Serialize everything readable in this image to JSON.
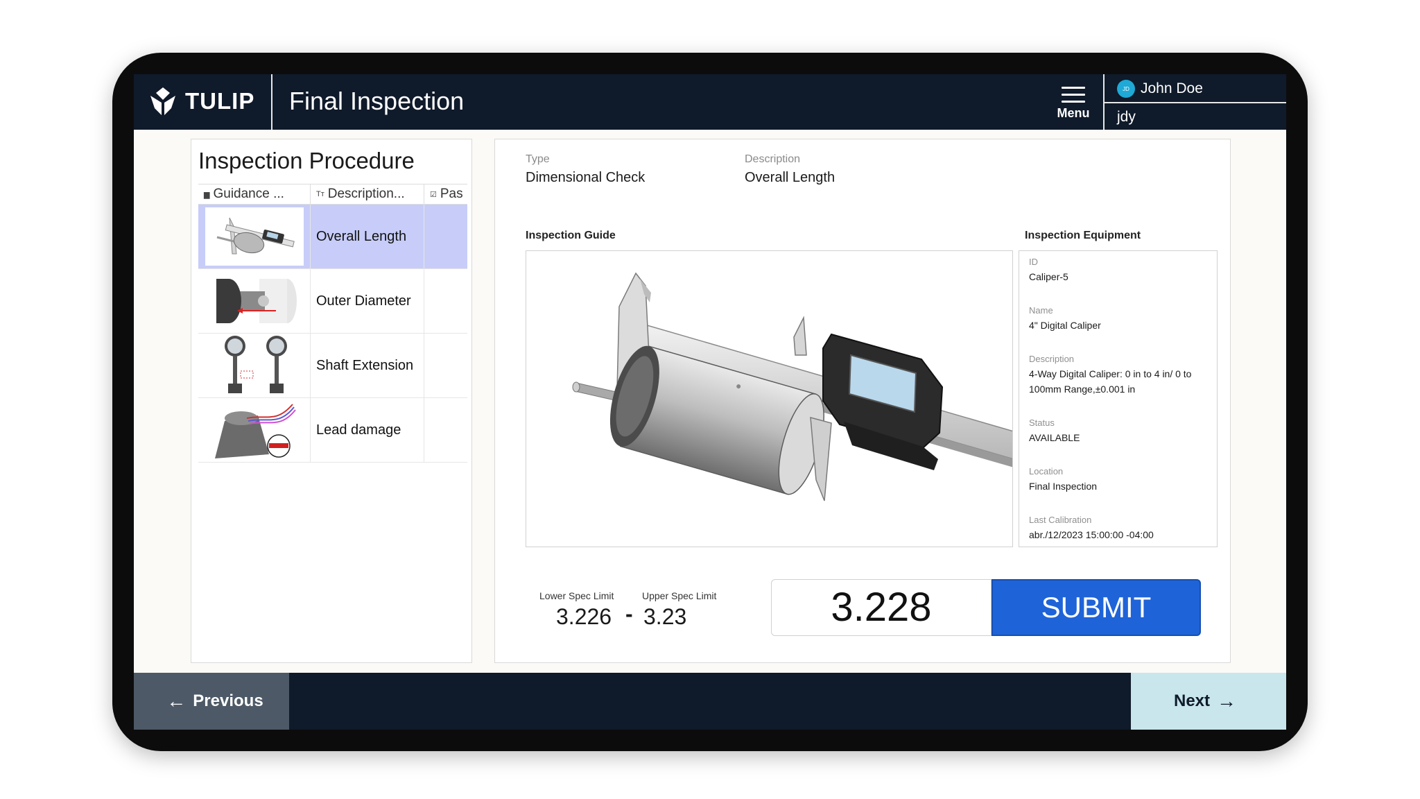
{
  "header": {
    "logo_text": "TULIP",
    "title": "Final Inspection",
    "menu_label": "Menu",
    "user_name": "John Doe",
    "user_initials": "JD",
    "user_id": "jdy"
  },
  "procedure": {
    "title": "Inspection Procedure",
    "columns": [
      "Guidance ...",
      "Description...",
      "Pas"
    ],
    "rows": [
      {
        "description": "Overall Length",
        "thumb": "caliper-cylinder",
        "selected": true
      },
      {
        "description": "Outer Diameter",
        "thumb": "outer-diameter",
        "selected": false
      },
      {
        "description": "Shaft Extension",
        "thumb": "dial-indicators",
        "selected": false
      },
      {
        "description": "Lead damage",
        "thumb": "lead-wires",
        "selected": false
      }
    ]
  },
  "detail": {
    "type_label": "Type",
    "type_value": "Dimensional Check",
    "desc_label": "Description",
    "desc_value": "Overall Length",
    "guide_label": "Inspection Guide",
    "equipment_label": "Inspection Equipment"
  },
  "equipment": {
    "id_label": "ID",
    "id_value": "Caliper-5",
    "name_label": "Name",
    "name_value": "4\" Digital Caliper",
    "desc_label": "Description",
    "desc_value": "4-Way Digital Caliper: 0 in to 4 in/ 0 to 100mm Range,±0.001 in",
    "status_label": "Status",
    "status_value": "AVAILABLE",
    "location_label": "Location",
    "location_value": "Final Inspection",
    "calibration_label": "Last Calibration",
    "calibration_value": "abr./12/2023 15:00:00 -04:00"
  },
  "spec": {
    "lower_label": "Lower Spec Limit",
    "upper_label": "Upper Spec Limit",
    "lower_value": "3.226",
    "upper_value": "3.23",
    "dash": "-"
  },
  "measurement": {
    "value": "3.228",
    "submit_label": "SUBMIT"
  },
  "footer": {
    "previous_label": "Previous",
    "next_label": "Next"
  },
  "colors": {
    "header_bg": "#0f1a2a",
    "selected_row": "#c7cdf8",
    "submit": "#1f63d8",
    "next_button": "#c8e6ec",
    "prev_button": "#4d5966"
  }
}
